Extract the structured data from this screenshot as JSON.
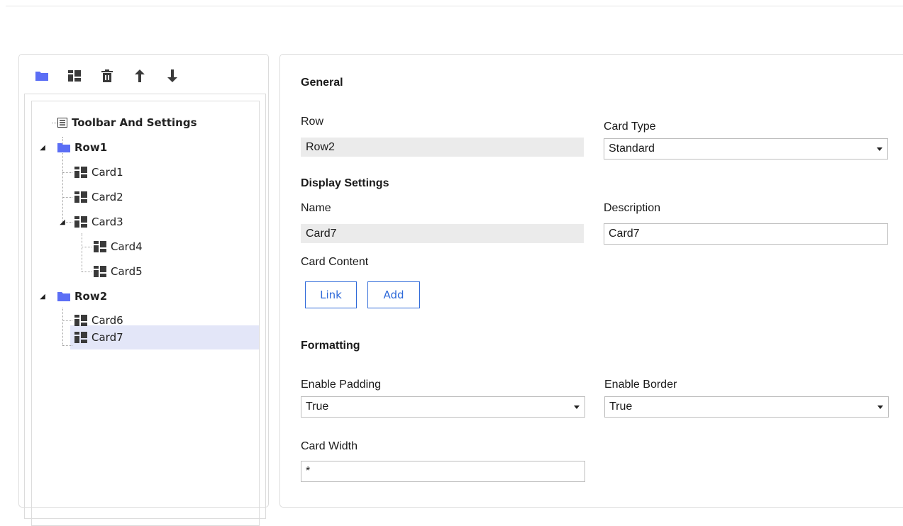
{
  "toolbar": {
    "buttons": [
      {
        "icon": "folder-icon"
      },
      {
        "icon": "card-icon"
      },
      {
        "icon": "trash-icon"
      },
      {
        "icon": "arrow-up-icon"
      },
      {
        "icon": "arrow-down-icon"
      }
    ]
  },
  "tree": {
    "settings": "Toolbar And Settings",
    "row1": "Row1",
    "card1": "Card1",
    "card2": "Card2",
    "card3": "Card3",
    "card4": "Card4",
    "card5": "Card5",
    "row2": "Row2",
    "card6": "Card6",
    "card7": "Card7",
    "selected": "Card7"
  },
  "form": {
    "general_title": "General",
    "row_label": "Row",
    "row_value": "Row2",
    "card_type_label": "Card Type",
    "card_type_value": "Standard",
    "display_title": "Display Settings",
    "name_label": "Name",
    "name_value": "Card7",
    "description_label": "Description",
    "description_value": "Card7",
    "card_content_label": "Card Content",
    "link_button": "Link",
    "add_button": "Add",
    "formatting_title": "Formatting",
    "enable_padding_label": "Enable Padding",
    "enable_padding_value": "True",
    "enable_border_label": "Enable Border",
    "enable_border_value": "True",
    "card_width_label": "Card Width",
    "card_width_value": "*"
  },
  "colors": {
    "accent": "#2f6ad9",
    "folder": "#5b6ef5",
    "selection": "#e3e6f8",
    "readonly_bg": "#ebebeb"
  }
}
